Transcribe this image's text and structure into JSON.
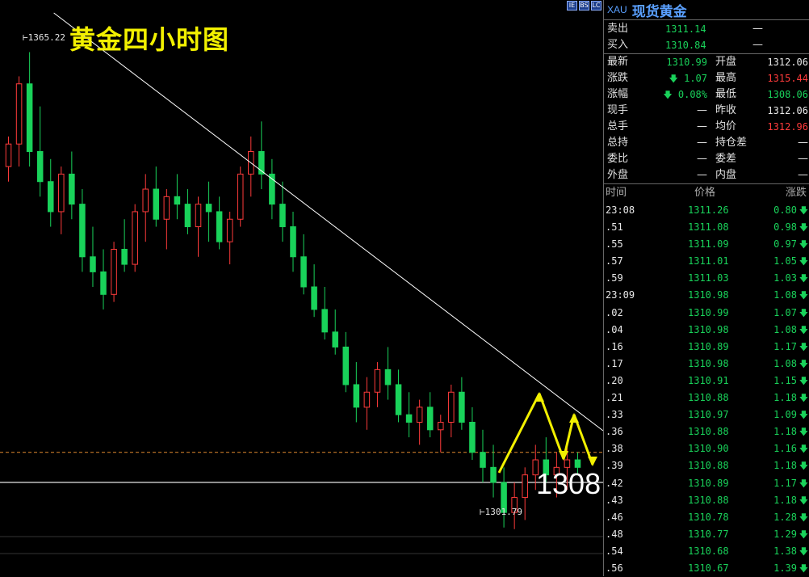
{
  "title": "黄金四小时图",
  "annotation_big": "1308",
  "high_label": "1365.22",
  "low_label": "1301.79",
  "colors": {
    "up": "#ff3b3b",
    "down": "#19d25a",
    "trend": "#ffffff",
    "dashed": "#e08a2e",
    "arrows": "#f2f000"
  },
  "chart_data": {
    "type": "candlestick",
    "title": "黄金四小时图",
    "ylim": [
      1298,
      1370
    ],
    "annotations": [
      {
        "text": "1365.22",
        "type": "high"
      },
      {
        "text": "1301.79",
        "type": "low"
      },
      {
        "text": "1308",
        "type": "support"
      }
    ],
    "support_levels": [
      1308,
      1312
    ],
    "candles": [
      [
        1350,
        1354,
        1348,
        1353
      ],
      [
        1353,
        1362,
        1350,
        1361
      ],
      [
        1361,
        1365.22,
        1350,
        1352
      ],
      [
        1352,
        1358,
        1346,
        1348
      ],
      [
        1348,
        1351,
        1342,
        1344
      ],
      [
        1344,
        1350,
        1341,
        1349
      ],
      [
        1349,
        1352,
        1343,
        1345
      ],
      [
        1345,
        1347,
        1336,
        1338
      ],
      [
        1338,
        1342,
        1334,
        1336
      ],
      [
        1336,
        1339,
        1331,
        1333
      ],
      [
        1333,
        1340,
        1332,
        1339
      ],
      [
        1339,
        1343,
        1336,
        1337
      ],
      [
        1337,
        1345,
        1336,
        1344
      ],
      [
        1344,
        1349,
        1340,
        1347
      ],
      [
        1347,
        1350,
        1342,
        1343
      ],
      [
        1343,
        1347,
        1339,
        1346
      ],
      [
        1346,
        1349,
        1343,
        1345
      ],
      [
        1345,
        1347,
        1341,
        1342
      ],
      [
        1342,
        1346,
        1338,
        1345
      ],
      [
        1345,
        1348,
        1340,
        1344
      ],
      [
        1344,
        1346,
        1339,
        1340
      ],
      [
        1340,
        1344,
        1337,
        1343
      ],
      [
        1343,
        1350,
        1342,
        1349
      ],
      [
        1349,
        1354,
        1346,
        1352
      ],
      [
        1352,
        1356,
        1347,
        1349
      ],
      [
        1349,
        1351,
        1343,
        1345
      ],
      [
        1345,
        1348,
        1340,
        1342
      ],
      [
        1342,
        1344,
        1336,
        1338
      ],
      [
        1338,
        1341,
        1333,
        1334
      ],
      [
        1334,
        1337,
        1330,
        1331
      ],
      [
        1331,
        1334,
        1327,
        1328
      ],
      [
        1328,
        1331,
        1325,
        1326
      ],
      [
        1326,
        1328,
        1320,
        1321
      ],
      [
        1321,
        1324,
        1316,
        1318
      ],
      [
        1318,
        1322,
        1315,
        1320
      ],
      [
        1320,
        1324,
        1318,
        1323
      ],
      [
        1323,
        1326,
        1319,
        1321
      ],
      [
        1321,
        1323,
        1316,
        1317
      ],
      [
        1317,
        1320,
        1314,
        1316
      ],
      [
        1316,
        1319,
        1313,
        1318
      ],
      [
        1318,
        1320,
        1314,
        1315
      ],
      [
        1315,
        1317,
        1312,
        1316
      ],
      [
        1316,
        1321,
        1314,
        1320
      ],
      [
        1320,
        1322,
        1315,
        1316
      ],
      [
        1316,
        1318,
        1311,
        1312
      ],
      [
        1312,
        1315,
        1308,
        1310
      ],
      [
        1310,
        1313,
        1306,
        1308
      ],
      [
        1308,
        1310,
        1302,
        1304
      ],
      [
        1304,
        1308,
        1301.79,
        1306
      ],
      [
        1306,
        1310,
        1303,
        1309
      ],
      [
        1309,
        1313,
        1307,
        1311
      ],
      [
        1311,
        1314,
        1308,
        1309
      ],
      [
        1309,
        1312,
        1306,
        1310
      ],
      [
        1310,
        1313,
        1307,
        1311
      ],
      [
        1311,
        1312,
        1309,
        1310
      ]
    ]
  },
  "panel": {
    "code": "XAU",
    "name": "现货黄金",
    "icons": [
      "IE",
      "BS",
      "LC"
    ],
    "sell_label": "卖出",
    "sell": "1311.14",
    "sell_vol": "—",
    "buy_label": "买入",
    "buy": "1310.84",
    "buy_vol": "—",
    "latest_label": "最新",
    "latest": "1310.99",
    "open_label": "开盘",
    "open": "1312.06",
    "change_label": "涨跌",
    "change": "1.07",
    "high_label": "最高",
    "high": "1315.44",
    "pct_label": "涨幅",
    "pct": "0.08%",
    "low_label": "最低",
    "low": "1308.06",
    "now_vol_label": "现手",
    "now_vol": "—",
    "prev_close_label": "昨收",
    "prev_close": "1312.06",
    "total_vol_label": "总手",
    "total_vol": "—",
    "avg_label": "均价",
    "avg": "1312.96",
    "total_hold_label": "总持",
    "total_hold": "—",
    "pos_diff_label": "持仓差",
    "pos_diff": "—",
    "bid_ratio_label": "委比",
    "bid_ratio": "—",
    "bid_diff_label": "委差",
    "bid_diff": "—",
    "outer_label": "外盘",
    "outer": "—",
    "inner_label": "内盘",
    "inner": "—",
    "ticks_header": {
      "time": "时间",
      "price": "价格",
      "change": "涨跌"
    },
    "ticks": [
      {
        "time": "23:08",
        "price": "1311.26",
        "change": "0.80"
      },
      {
        "time": ".51",
        "price": "1311.08",
        "change": "0.98"
      },
      {
        "time": ".55",
        "price": "1311.09",
        "change": "0.97"
      },
      {
        "time": ".57",
        "price": "1311.01",
        "change": "1.05"
      },
      {
        "time": ".59",
        "price": "1311.03",
        "change": "1.03"
      },
      {
        "time": "23:09",
        "price": "1310.98",
        "change": "1.08"
      },
      {
        "time": ".02",
        "price": "1310.99",
        "change": "1.07"
      },
      {
        "time": ".04",
        "price": "1310.98",
        "change": "1.08"
      },
      {
        "time": ".16",
        "price": "1310.89",
        "change": "1.17"
      },
      {
        "time": ".17",
        "price": "1310.98",
        "change": "1.08"
      },
      {
        "time": ".20",
        "price": "1310.91",
        "change": "1.15"
      },
      {
        "time": ".21",
        "price": "1310.88",
        "change": "1.18"
      },
      {
        "time": ".33",
        "price": "1310.97",
        "change": "1.09"
      },
      {
        "time": ".36",
        "price": "1310.88",
        "change": "1.18"
      },
      {
        "time": ".38",
        "price": "1310.90",
        "change": "1.16"
      },
      {
        "time": ".39",
        "price": "1310.88",
        "change": "1.18"
      },
      {
        "time": ".42",
        "price": "1310.89",
        "change": "1.17"
      },
      {
        "time": ".43",
        "price": "1310.88",
        "change": "1.18"
      },
      {
        "time": ".46",
        "price": "1310.78",
        "change": "1.28"
      },
      {
        "time": ".48",
        "price": "1310.77",
        "change": "1.29"
      },
      {
        "time": ".54",
        "price": "1310.68",
        "change": "1.38"
      },
      {
        "time": ".56",
        "price": "1310.67",
        "change": "1.39"
      }
    ]
  }
}
